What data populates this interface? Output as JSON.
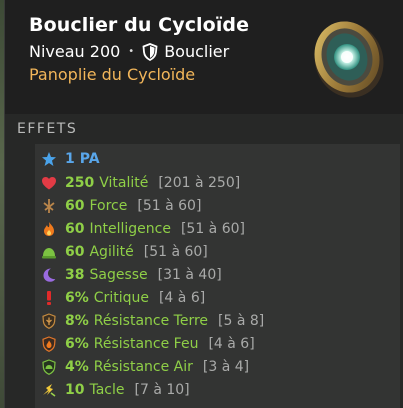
{
  "item": {
    "name": "Bouclier du Cycloïde",
    "level": "Niveau 200",
    "separator": "•",
    "type": "Bouclier",
    "set": "Panoplie du Cycloïde"
  },
  "effects_title": "EFFETS",
  "effects": [
    {
      "value": "1",
      "name": "PA",
      "range": "",
      "icon": "star-icon",
      "color": "#59a6ea"
    },
    {
      "value": "250",
      "name": "Vitalité",
      "range": "[201 à 250]",
      "icon": "heart-icon",
      "color": "#8fcf47"
    },
    {
      "value": "60",
      "name": "Force",
      "range": "[51 à 60]",
      "icon": "strength-icon",
      "color": "#8fcf47"
    },
    {
      "value": "60",
      "name": "Intelligence",
      "range": "[51 à 60]",
      "icon": "fire-icon",
      "color": "#8fcf47"
    },
    {
      "value": "60",
      "name": "Agilité",
      "range": "[51 à 60]",
      "icon": "agility-icon",
      "color": "#8fcf47"
    },
    {
      "value": "38",
      "name": "Sagesse",
      "range": "[31 à 40]",
      "icon": "wisdom-icon",
      "color": "#8fcf47"
    },
    {
      "value": "6%",
      "name": "Critique",
      "range": "[4 à 6]",
      "icon": "critical-icon",
      "color": "#8fcf47"
    },
    {
      "value": "8%",
      "name": "Résistance Terre",
      "range": "[5 à 8]",
      "icon": "earth-resistance-icon",
      "color": "#8fcf47"
    },
    {
      "value": "6%",
      "name": "Résistance Feu",
      "range": "[4 à 6]",
      "icon": "fire-resistance-icon",
      "color": "#8fcf47"
    },
    {
      "value": "4%",
      "name": "Résistance Air",
      "range": "[3 à 4]",
      "icon": "air-resistance-icon",
      "color": "#8fcf47"
    },
    {
      "value": "10",
      "name": "Tacle",
      "range": "[7 à 10]",
      "icon": "tackle-icon",
      "color": "#8fcf47"
    }
  ]
}
